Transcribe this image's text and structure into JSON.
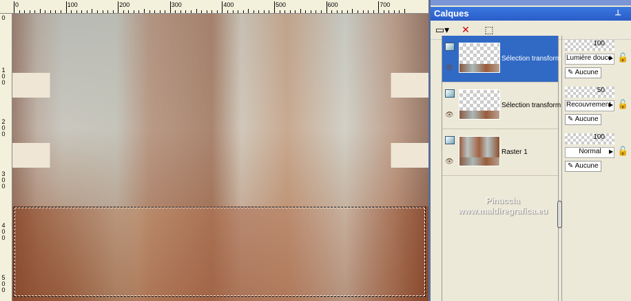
{
  "ruler": {
    "top_labels": [
      "0",
      "100",
      "200",
      "300",
      "400",
      "500",
      "600",
      "700"
    ],
    "left_labels": [
      "0",
      "100",
      "200",
      "300",
      "400",
      "500"
    ]
  },
  "palette": {
    "title": "Calques",
    "pin_icon": "pin-icon",
    "layers": [
      {
        "name": "Sélection transform",
        "opacity": "100",
        "blend": "Lumière douce",
        "mask": "Aucune",
        "selected": true
      },
      {
        "name": "Sélection transform",
        "opacity": "50",
        "blend": "Recouvrement",
        "mask": "Aucune",
        "selected": false
      },
      {
        "name": "Raster 1",
        "opacity": "100",
        "blend": "Normal",
        "mask": "Aucune",
        "selected": false
      }
    ]
  },
  "watermark": {
    "line1": "Pinuccia",
    "line2": "www.maldiregrafica.eu"
  }
}
